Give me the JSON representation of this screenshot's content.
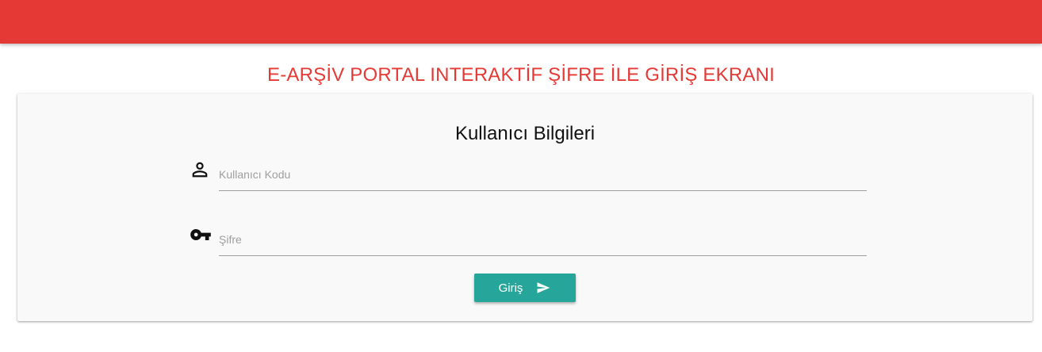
{
  "page": {
    "title": "E-ARŞİV PORTAL INTERAKTİF ŞİFRE İLE GİRİŞ EKRANI"
  },
  "colors": {
    "header": "#e53935",
    "title": "#e53935",
    "button": "#26a69a",
    "card_bg": "#f9f9f9"
  },
  "login_card": {
    "heading": "Kullanıcı Bilgileri",
    "username": {
      "icon": "person-icon",
      "placeholder": "Kullanıcı Kodu",
      "value": ""
    },
    "password": {
      "icon": "key-icon",
      "placeholder": "Şifre",
      "value": ""
    },
    "submit": {
      "label": "Giriş",
      "icon": "send-icon"
    }
  }
}
